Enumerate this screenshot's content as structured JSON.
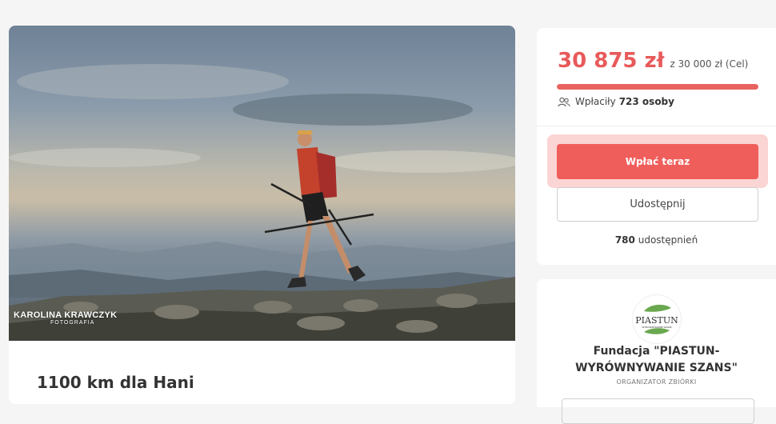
{
  "campaign": {
    "title": "1100 km dla Hani",
    "photo": {
      "watermark_name": "KAROLINA KRAWCZYK",
      "watermark_sub": "FOTOGRAFIA"
    }
  },
  "donation": {
    "amount_raised": "30 875 zł",
    "goal_text": "z 30 000 zł (Cel)",
    "progress_percent": 100,
    "donors_prefix": "Wpłaciły",
    "donors_count": "723 osoby",
    "donate_label": "Wpłać teraz",
    "share_label": "Udostępnij",
    "shares_count": "780",
    "shares_suffix": "udostępnień"
  },
  "organizer": {
    "logo_text": "PIASTUN",
    "logo_subtext": "WYRÓWNYWANIE SZANS",
    "name": "Fundacja \"PIASTUN-WYRÓWNYWANIE SZANS\"",
    "role": "ORGANIZATOR ZBIÓRKI"
  },
  "colors": {
    "accent": "#ef5e5b",
    "progress_bg": "#f3c3c3",
    "page_bg": "#f5f5f5"
  },
  "icons": {
    "donors": "people-icon",
    "logo": "leaf-logo"
  }
}
